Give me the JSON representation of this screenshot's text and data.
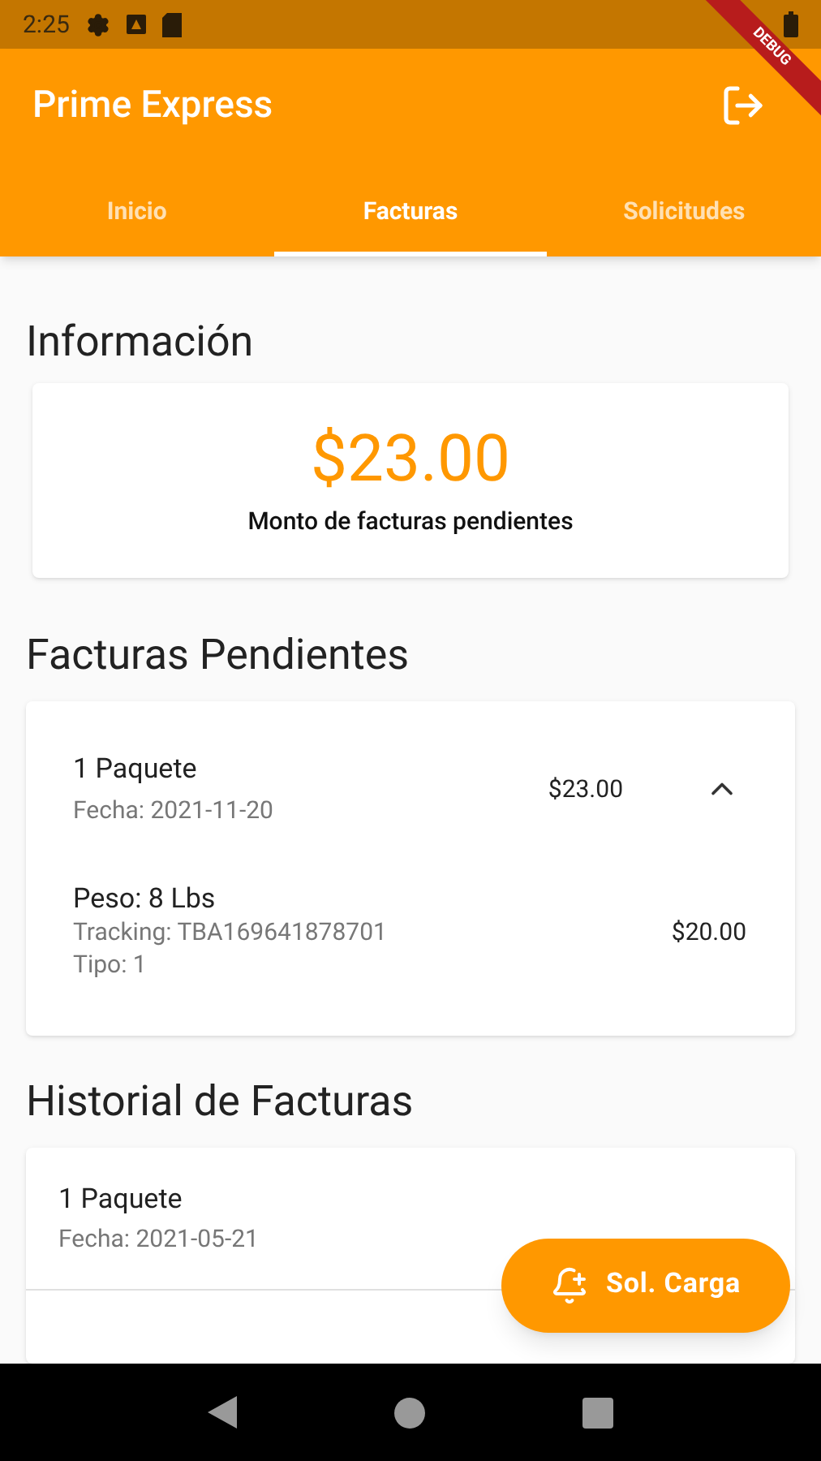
{
  "status_bar": {
    "time": "2:25"
  },
  "debug_banner": "DEBUG",
  "app_bar": {
    "title": "Prime Express"
  },
  "tabs": [
    {
      "label": "Inicio",
      "selected": false
    },
    {
      "label": "Facturas",
      "selected": true
    },
    {
      "label": "Solicitudes",
      "selected": false
    }
  ],
  "info": {
    "heading": "Información",
    "amount": "$23.00",
    "caption": "Monto de facturas pendientes"
  },
  "pending": {
    "heading": "Facturas Pendientes",
    "items": [
      {
        "title": "1 Paquete",
        "date": "Fecha: 2021-11-20",
        "amount": "$23.00",
        "expanded": true,
        "details": [
          {
            "weight": "Peso: 8 Lbs",
            "tracking": "Tracking: TBA169641878701",
            "type": "Tipo: 1",
            "amount": "$20.00"
          }
        ]
      }
    ]
  },
  "history": {
    "heading": "Historial de Facturas",
    "items": [
      {
        "title": "1 Paquete",
        "date": "Fecha: 2021-05-21"
      }
    ]
  },
  "fab": {
    "label": "Sol. Carga"
  }
}
